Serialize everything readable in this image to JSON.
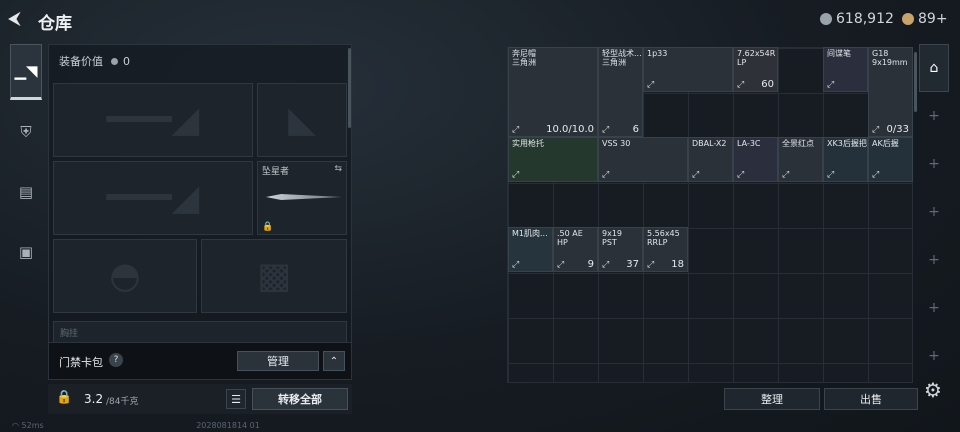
{
  "header": {
    "title": "仓库",
    "currency1": "618,912",
    "currency2": "89+"
  },
  "left": {
    "equipment_value_label": "装备价值",
    "equipment_value": "0",
    "knife_name": "坠星者",
    "pouch_label": "门禁卡包",
    "pouch_help": "?",
    "manage_label": "管理",
    "capacity_value": "3.2",
    "capacity_total": "/84千克",
    "transfer_all": "转移全部",
    "hidden_label": "胸挂"
  },
  "stash": {
    "items": [
      {
        "name": "奔尼帽\n三角洲",
        "count": "10.0/10.0"
      },
      {
        "name": "轻型战术...\n三角洲",
        "count": "6"
      },
      {
        "name": "1p33",
        "count": ""
      },
      {
        "name": "7.62x54R\nLP",
        "count": "60"
      },
      {
        "name": "间谍笔",
        "count": ""
      },
      {
        "name": "G18\n9x19mm",
        "count": "0/33"
      },
      {
        "name": "实用枪托",
        "count": ""
      },
      {
        "name": "VSS 30",
        "count": ""
      },
      {
        "name": "DBAL-X2",
        "count": ""
      },
      {
        "name": "LA-3C",
        "count": ""
      },
      {
        "name": "全景红点",
        "count": ""
      },
      {
        "name": "XK3后握把",
        "count": ""
      },
      {
        "name": "AK后握",
        "count": ""
      },
      {
        "name": "M1肌肉...",
        "count": ""
      },
      {
        "name": ".50 AE\nHP",
        "count": "9"
      },
      {
        "name": "9x19\nPST",
        "count": "37"
      },
      {
        "name": "5.56x45\nRRLP",
        "count": "18"
      }
    ]
  },
  "actions": {
    "sort": "整理",
    "sell": "出售"
  },
  "status": {
    "ping": "52ms",
    "build": "2028081814 01"
  }
}
